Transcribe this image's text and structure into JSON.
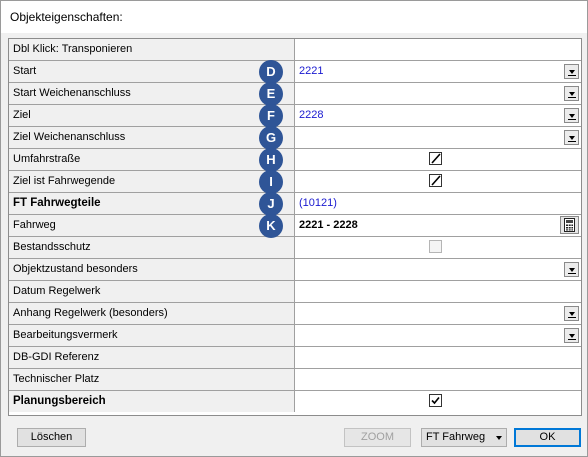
{
  "window": {
    "title": "Objekteigenschaften:"
  },
  "grid": {
    "rows": [
      {
        "label": "Dbl Klick: Transponieren",
        "bold": false,
        "badge": "",
        "value": "",
        "value_style": "",
        "control": "none"
      },
      {
        "label": "Start",
        "bold": false,
        "badge": "D",
        "value": "2221",
        "value_style": "link",
        "control": "dropdown"
      },
      {
        "label": "Start Weichenanschluss",
        "bold": false,
        "badge": "E",
        "value": "",
        "value_style": "",
        "control": "dropdown"
      },
      {
        "label": "Ziel",
        "bold": false,
        "badge": "F",
        "value": "2228",
        "value_style": "link",
        "control": "dropdown"
      },
      {
        "label": "Ziel Weichenanschluss",
        "bold": false,
        "badge": "G",
        "value": "",
        "value_style": "",
        "control": "dropdown"
      },
      {
        "label": "Umfahrstraße",
        "bold": false,
        "badge": "H",
        "value": "",
        "value_style": "",
        "control": "checkbox-slash"
      },
      {
        "label": "Ziel ist Fahrwegende",
        "bold": false,
        "badge": "I",
        "value": "",
        "value_style": "",
        "control": "checkbox-slash"
      },
      {
        "label": "FT Fahrwegteile",
        "bold": true,
        "badge": "J",
        "value": "(10121)",
        "value_style": "link",
        "control": "none"
      },
      {
        "label": "Fahrweg",
        "bold": false,
        "badge": "K",
        "value": "2221 - 2228",
        "value_style": "bold",
        "control": "calculator"
      },
      {
        "label": "Bestandsschutz",
        "bold": false,
        "badge": "",
        "value": "",
        "value_style": "",
        "control": "checkbox-disabled"
      },
      {
        "label": "Objektzustand besonders",
        "bold": false,
        "badge": "",
        "value": "",
        "value_style": "",
        "control": "dropdown"
      },
      {
        "label": "Datum Regelwerk",
        "bold": false,
        "badge": "",
        "value": "",
        "value_style": "",
        "control": "none"
      },
      {
        "label": "Anhang Regelwerk (besonders)",
        "bold": false,
        "badge": "",
        "value": "",
        "value_style": "",
        "control": "dropdown"
      },
      {
        "label": "Bearbeitungsvermerk",
        "bold": false,
        "badge": "",
        "value": "",
        "value_style": "",
        "control": "dropdown"
      },
      {
        "label": "DB-GDI Referenz",
        "bold": false,
        "badge": "",
        "value": "",
        "value_style": "",
        "control": "none"
      },
      {
        "label": "Technischer Platz",
        "bold": false,
        "badge": "",
        "value": "",
        "value_style": "",
        "control": "none"
      },
      {
        "label": "Planungsbereich",
        "bold": true,
        "badge": "",
        "value": "",
        "value_style": "",
        "control": "checkbox-checked"
      }
    ]
  },
  "footer": {
    "delete_label": "Löschen",
    "zoom_label": "ZOOM",
    "view_select_value": "FT Fahrweg",
    "ok_label": "OK"
  },
  "colors": {
    "badge": "#2f5597",
    "link_value": "#1a1ad0",
    "default_button_border": "#0078d7"
  }
}
